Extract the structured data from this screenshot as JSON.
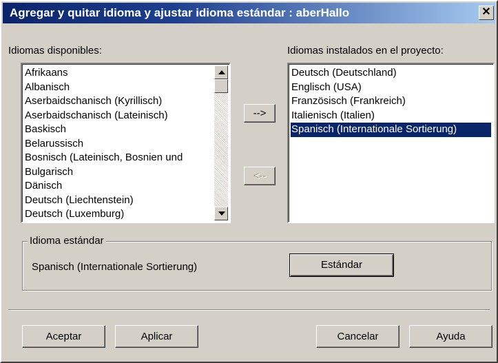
{
  "window": {
    "title": "Agregar y quitar idioma y ajustar idioma estándar : aberHallo",
    "close_label": "✕"
  },
  "available": {
    "label": "Idiomas disponibles:",
    "items": [
      "Afrikaans",
      "Albanisch",
      "Aserbaidschanisch (Kyrillisch)",
      "Aserbaidschanisch (Lateinisch)",
      "Baskisch",
      "Belarussisch",
      "Bosnisch (Lateinisch, Bosnien und",
      "Bulgarisch",
      "Dänisch",
      "Deutsch (Liechtenstein)",
      "Deutsch (Luxemburg)"
    ]
  },
  "installed": {
    "label": "Idiomas instalados en el proyecto:",
    "items": [
      "Deutsch (Deutschland)",
      "Englisch (USA)",
      "Französisch (Frankreich)",
      "Italienisch (Italien)",
      "Spanisch (Internationale Sortierung)"
    ],
    "selected_index": 4
  },
  "transfer": {
    "add_label": "-->",
    "remove_label": "<--"
  },
  "standard": {
    "group_title": "Idioma estándar",
    "current_value": "Spanisch (Internationale Sortierung)",
    "button_label": "Estándar"
  },
  "footer": {
    "accept_label": "Aceptar",
    "apply_label": "Aplicar",
    "cancel_label": "Cancelar",
    "help_label": "Ayuda"
  },
  "colors": {
    "selection": "#0a246a",
    "face": "#d4d0c8"
  }
}
